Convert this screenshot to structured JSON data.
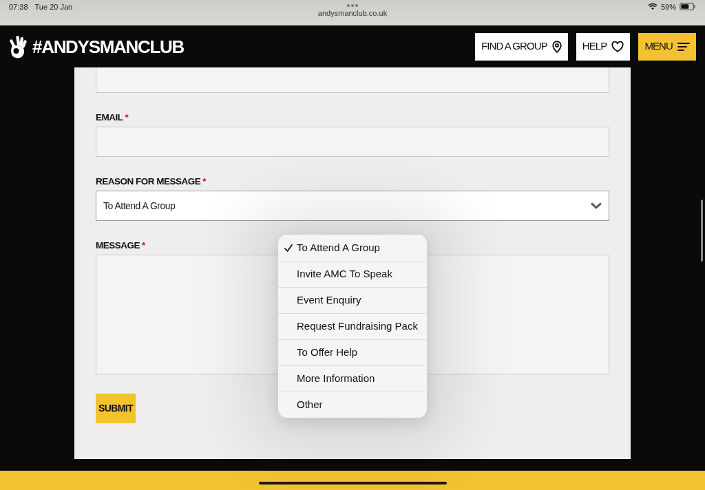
{
  "status_bar": {
    "time": "07:38",
    "date": "Tue 20 Jan",
    "url": "andysmanclub.co.uk",
    "battery": "59%"
  },
  "header": {
    "logo": "#ANDYSMANCLUB",
    "buttons": [
      {
        "label": "FIND A GROUP",
        "kind": "location"
      },
      {
        "label": "HELP",
        "kind": "heart"
      },
      {
        "label": "MENU",
        "kind": "menu"
      }
    ]
  },
  "form": {
    "fields": [
      {
        "kind": "text"
      },
      {
        "kind": "text",
        "label": "EMAIL",
        "required_mark": "*"
      },
      {
        "kind": "select",
        "label": "REASON FOR MESSAGE",
        "required_mark": "*",
        "value": "To Attend A Group"
      },
      {
        "kind": "textarea",
        "label": "MESSAGE",
        "required_mark": "*"
      }
    ],
    "submit": "SUBMIT"
  },
  "dropdown": {
    "options": [
      {
        "label": "To Attend A Group",
        "selected": true
      },
      {
        "label": "Invite AMC To Speak",
        "selected": false
      },
      {
        "label": "Event Enquiry",
        "selected": false
      },
      {
        "label": "Request Fundraising Pack",
        "selected": false
      },
      {
        "label": "To Offer Help",
        "selected": false
      },
      {
        "label": "More Information",
        "selected": false
      },
      {
        "label": "Other",
        "selected": false
      }
    ]
  }
}
